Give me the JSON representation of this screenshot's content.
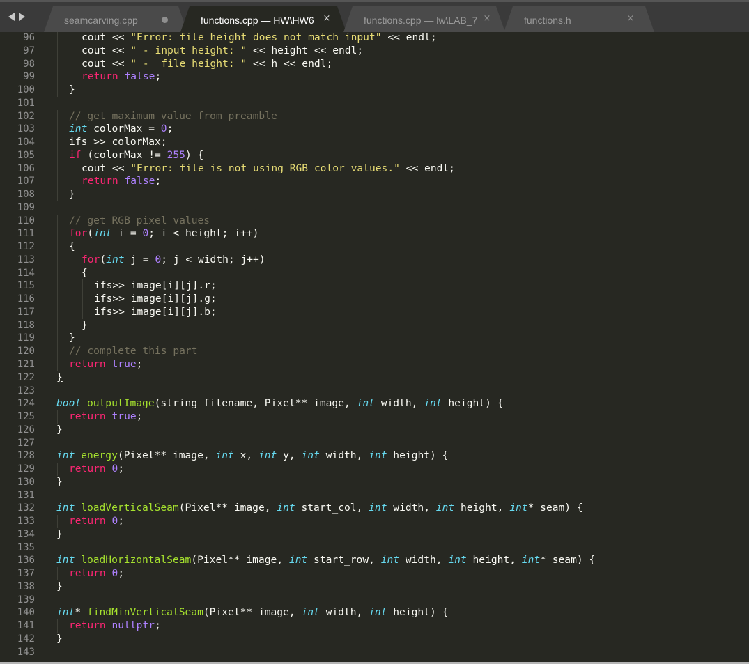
{
  "tabs": [
    {
      "label": "seamcarving.cpp",
      "active": false,
      "state": "dirty"
    },
    {
      "label": "functions.cpp — HW\\HW6",
      "active": true,
      "state": "close"
    },
    {
      "label": "functions.cpp — lw\\LAB_7",
      "active": false,
      "state": "close"
    },
    {
      "label": "functions.h",
      "active": false,
      "state": "close"
    }
  ],
  "icons": {
    "nav_back": "triangle-left-icon",
    "nav_forward": "triangle-right-icon",
    "close": "×",
    "dirty": "dot-icon"
  },
  "syntax_colors": {
    "background": "#272822",
    "keyword": "#f92672",
    "type": "#66d9ef",
    "function": "#a6e22e",
    "string": "#e6db74",
    "number": "#ae81ff",
    "comment": "#75715e",
    "text": "#f8f8f2",
    "gutter": "#909090"
  },
  "code_lines": [
    {
      "n": "96",
      "indent": 2,
      "tokens": [
        [
          "p",
          "cout << "
        ],
        [
          "s",
          "\"Error: file height does not match input\""
        ],
        [
          "p",
          " << endl;"
        ]
      ]
    },
    {
      "n": "97",
      "indent": 2,
      "tokens": [
        [
          "p",
          "cout << "
        ],
        [
          "s",
          "\" - input height: \""
        ],
        [
          "p",
          " << height << endl;"
        ]
      ]
    },
    {
      "n": "98",
      "indent": 2,
      "tokens": [
        [
          "p",
          "cout << "
        ],
        [
          "s",
          "\" -  file height: \""
        ],
        [
          "p",
          " << h << endl;"
        ]
      ]
    },
    {
      "n": "99",
      "indent": 2,
      "tokens": [
        [
          "k",
          "return "
        ],
        [
          "m",
          "false"
        ],
        [
          "p",
          ";"
        ]
      ]
    },
    {
      "n": "100",
      "indent": 1,
      "tokens": [
        [
          "p",
          "}"
        ]
      ]
    },
    {
      "n": "101",
      "indent": 0,
      "tokens": []
    },
    {
      "n": "102",
      "indent": 1,
      "tokens": [
        [
          "c",
          "// get maximum value from preamble"
        ]
      ]
    },
    {
      "n": "103",
      "indent": 1,
      "tokens": [
        [
          "t",
          "int"
        ],
        [
          "p",
          " colorMax = "
        ],
        [
          "m",
          "0"
        ],
        [
          "p",
          ";"
        ]
      ]
    },
    {
      "n": "104",
      "indent": 1,
      "tokens": [
        [
          "p",
          "ifs >> colorMax;"
        ]
      ]
    },
    {
      "n": "105",
      "indent": 1,
      "tokens": [
        [
          "k",
          "if"
        ],
        [
          "p",
          " (colorMax != "
        ],
        [
          "m",
          "255"
        ],
        [
          "p",
          ") {"
        ]
      ]
    },
    {
      "n": "106",
      "indent": 2,
      "tokens": [
        [
          "p",
          "cout << "
        ],
        [
          "s",
          "\"Error: file is not using RGB color values.\""
        ],
        [
          "p",
          " << endl;"
        ]
      ]
    },
    {
      "n": "107",
      "indent": 2,
      "tokens": [
        [
          "k",
          "return "
        ],
        [
          "m",
          "false"
        ],
        [
          "p",
          ";"
        ]
      ]
    },
    {
      "n": "108",
      "indent": 1,
      "tokens": [
        [
          "p",
          "}"
        ]
      ]
    },
    {
      "n": "109",
      "indent": 0,
      "tokens": []
    },
    {
      "n": "110",
      "indent": 1,
      "tokens": [
        [
          "c",
          "// get RGB pixel values"
        ]
      ]
    },
    {
      "n": "111",
      "indent": 1,
      "tokens": [
        [
          "k",
          "for"
        ],
        [
          "p",
          "("
        ],
        [
          "t",
          "int"
        ],
        [
          "p",
          " i = "
        ],
        [
          "m",
          "0"
        ],
        [
          "p",
          "; i < height; i++)"
        ]
      ]
    },
    {
      "n": "112",
      "indent": 1,
      "tokens": [
        [
          "p",
          "{"
        ]
      ]
    },
    {
      "n": "113",
      "indent": 2,
      "tokens": [
        [
          "k",
          "for"
        ],
        [
          "p",
          "("
        ],
        [
          "t",
          "int"
        ],
        [
          "p",
          " j = "
        ],
        [
          "m",
          "0"
        ],
        [
          "p",
          "; j < width; j++)"
        ]
      ]
    },
    {
      "n": "114",
      "indent": 2,
      "tokens": [
        [
          "p",
          "{"
        ]
      ]
    },
    {
      "n": "115",
      "indent": 3,
      "tokens": [
        [
          "p",
          "ifs>> image[i][j].r;"
        ]
      ]
    },
    {
      "n": "116",
      "indent": 3,
      "tokens": [
        [
          "p",
          "ifs>> image[i][j].g;"
        ]
      ]
    },
    {
      "n": "117",
      "indent": 3,
      "tokens": [
        [
          "p",
          "ifs>> image[i][j].b;"
        ]
      ]
    },
    {
      "n": "118",
      "indent": 2,
      "tokens": [
        [
          "p",
          "}"
        ]
      ]
    },
    {
      "n": "119",
      "indent": 1,
      "tokens": [
        [
          "p",
          "}"
        ]
      ]
    },
    {
      "n": "120",
      "indent": 1,
      "tokens": [
        [
          "c",
          "// complete this part"
        ]
      ]
    },
    {
      "n": "121",
      "indent": 1,
      "tokens": [
        [
          "k",
          "return "
        ],
        [
          "m",
          "true"
        ],
        [
          "p",
          ";"
        ]
      ]
    },
    {
      "n": "122",
      "indent": 0,
      "tokens": [
        [
          "u",
          "}"
        ]
      ]
    },
    {
      "n": "123",
      "indent": 0,
      "tokens": []
    },
    {
      "n": "124",
      "indent": 0,
      "tokens": [
        [
          "t",
          "bool"
        ],
        [
          "p",
          " "
        ],
        [
          "f",
          "outputImage"
        ],
        [
          "p",
          "(string filename, Pixel** image, "
        ],
        [
          "t",
          "int"
        ],
        [
          "p",
          " width, "
        ],
        [
          "t",
          "int"
        ],
        [
          "p",
          " height) {"
        ]
      ]
    },
    {
      "n": "125",
      "indent": 1,
      "tokens": [
        [
          "k",
          "return "
        ],
        [
          "m",
          "true"
        ],
        [
          "p",
          ";"
        ]
      ]
    },
    {
      "n": "126",
      "indent": 0,
      "tokens": [
        [
          "p",
          "}"
        ]
      ]
    },
    {
      "n": "127",
      "indent": 0,
      "tokens": []
    },
    {
      "n": "128",
      "indent": 0,
      "tokens": [
        [
          "t",
          "int"
        ],
        [
          "p",
          " "
        ],
        [
          "f",
          "energy"
        ],
        [
          "p",
          "(Pixel** image, "
        ],
        [
          "t",
          "int"
        ],
        [
          "p",
          " x, "
        ],
        [
          "t",
          "int"
        ],
        [
          "p",
          " y, "
        ],
        [
          "t",
          "int"
        ],
        [
          "p",
          " width, "
        ],
        [
          "t",
          "int"
        ],
        [
          "p",
          " height) {"
        ]
      ]
    },
    {
      "n": "129",
      "indent": 1,
      "tokens": [
        [
          "k",
          "return "
        ],
        [
          "m",
          "0"
        ],
        [
          "p",
          ";"
        ]
      ]
    },
    {
      "n": "130",
      "indent": 0,
      "tokens": [
        [
          "p",
          "}"
        ]
      ]
    },
    {
      "n": "131",
      "indent": 0,
      "tokens": []
    },
    {
      "n": "132",
      "indent": 0,
      "tokens": [
        [
          "t",
          "int"
        ],
        [
          "p",
          " "
        ],
        [
          "f",
          "loadVerticalSeam"
        ],
        [
          "p",
          "(Pixel** image, "
        ],
        [
          "t",
          "int"
        ],
        [
          "p",
          " start_col, "
        ],
        [
          "t",
          "int"
        ],
        [
          "p",
          " width, "
        ],
        [
          "t",
          "int"
        ],
        [
          "p",
          " height, "
        ],
        [
          "t",
          "int"
        ],
        [
          "p",
          "* seam) {"
        ]
      ]
    },
    {
      "n": "133",
      "indent": 1,
      "tokens": [
        [
          "k",
          "return "
        ],
        [
          "m",
          "0"
        ],
        [
          "p",
          ";"
        ]
      ]
    },
    {
      "n": "134",
      "indent": 0,
      "tokens": [
        [
          "p",
          "}"
        ]
      ]
    },
    {
      "n": "135",
      "indent": 0,
      "tokens": []
    },
    {
      "n": "136",
      "indent": 0,
      "tokens": [
        [
          "t",
          "int"
        ],
        [
          "p",
          " "
        ],
        [
          "f",
          "loadHorizontalSeam"
        ],
        [
          "p",
          "(Pixel** image, "
        ],
        [
          "t",
          "int"
        ],
        [
          "p",
          " start_row, "
        ],
        [
          "t",
          "int"
        ],
        [
          "p",
          " width, "
        ],
        [
          "t",
          "int"
        ],
        [
          "p",
          " height, "
        ],
        [
          "t",
          "int"
        ],
        [
          "p",
          "* seam) {"
        ]
      ]
    },
    {
      "n": "137",
      "indent": 1,
      "tokens": [
        [
          "k",
          "return "
        ],
        [
          "m",
          "0"
        ],
        [
          "p",
          ";"
        ]
      ]
    },
    {
      "n": "138",
      "indent": 0,
      "tokens": [
        [
          "p",
          "}"
        ]
      ]
    },
    {
      "n": "139",
      "indent": 0,
      "tokens": []
    },
    {
      "n": "140",
      "indent": 0,
      "tokens": [
        [
          "t",
          "int"
        ],
        [
          "p",
          "* "
        ],
        [
          "f",
          "findMinVerticalSeam"
        ],
        [
          "p",
          "(Pixel** image, "
        ],
        [
          "t",
          "int"
        ],
        [
          "p",
          " width, "
        ],
        [
          "t",
          "int"
        ],
        [
          "p",
          " height) {"
        ]
      ]
    },
    {
      "n": "141",
      "indent": 1,
      "tokens": [
        [
          "k",
          "return "
        ],
        [
          "m",
          "nullptr"
        ],
        [
          "p",
          ";"
        ]
      ]
    },
    {
      "n": "142",
      "indent": 0,
      "tokens": [
        [
          "p",
          "}"
        ]
      ]
    },
    {
      "n": "143",
      "indent": 0,
      "tokens": []
    }
  ]
}
